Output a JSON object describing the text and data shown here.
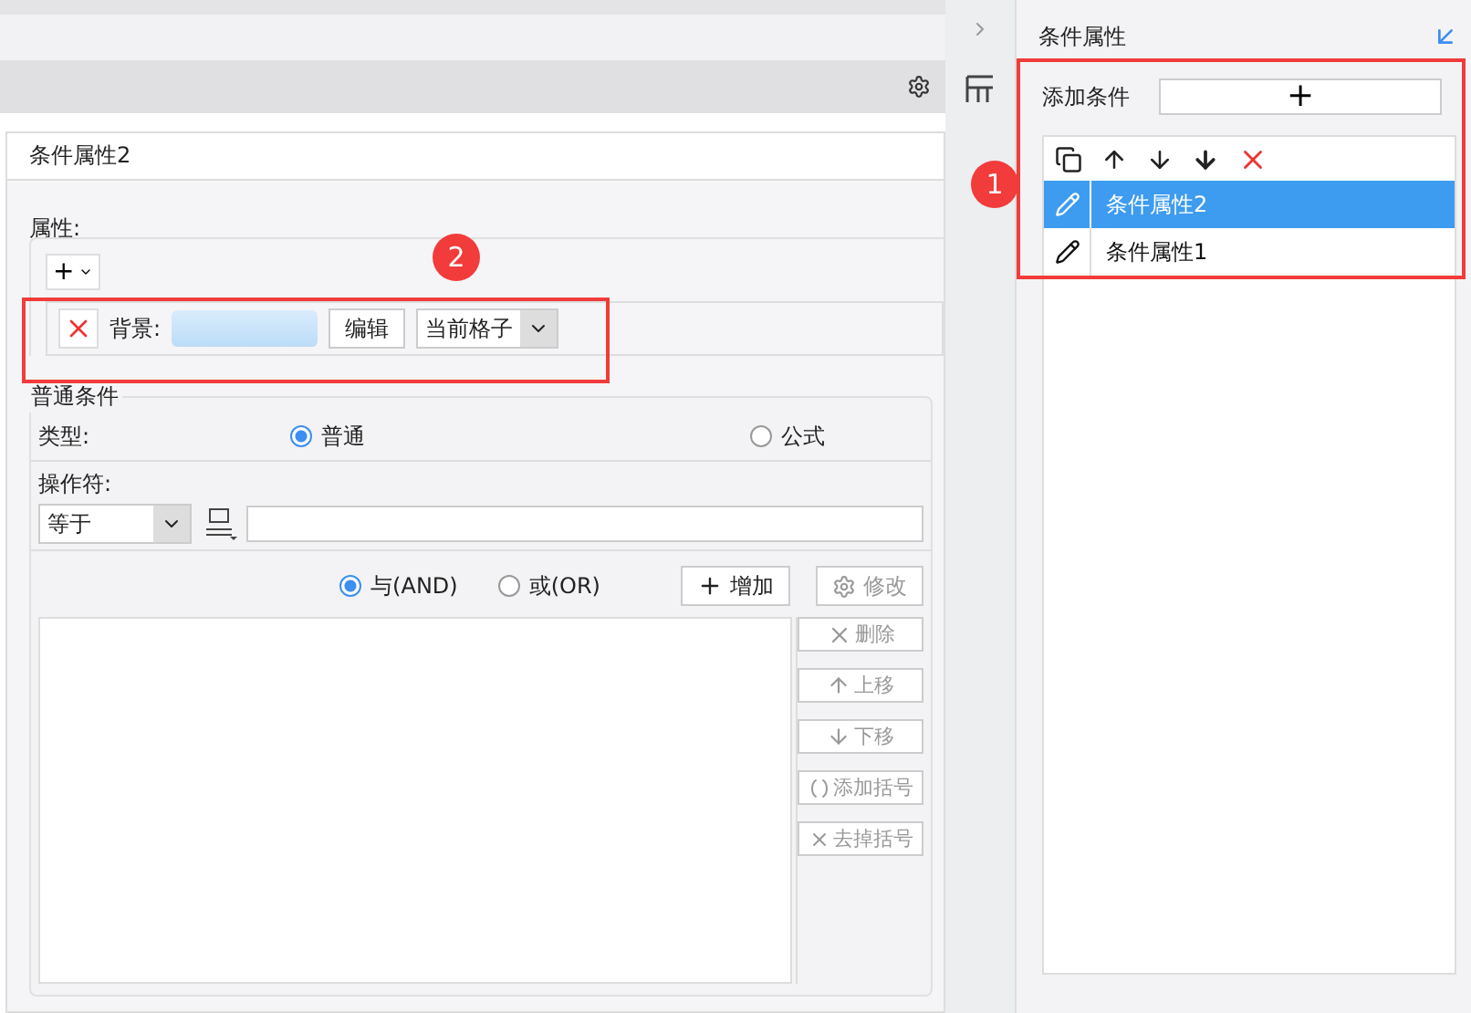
{
  "editor": {
    "tab": "条件属性2",
    "attributes": {
      "label": "属性:",
      "add_button": "+",
      "rows": [
        {
          "label": "背景:",
          "edit_button": "编辑",
          "scope": "当前格子"
        }
      ]
    },
    "condition": {
      "title": "普通条件",
      "type_label": "类型:",
      "types": [
        {
          "label": "普通",
          "selected": true
        },
        {
          "label": "公式",
          "selected": false
        }
      ],
      "operator_label": "操作符:",
      "operator": "等于",
      "logic": [
        {
          "label": "与(AND)",
          "selected": true
        },
        {
          "label": "或(OR)",
          "selected": false
        }
      ],
      "add_button": "增加",
      "modify_button": {
        "label": "修改",
        "disabled": true
      },
      "side_buttons": [
        {
          "kind": "delete",
          "label": "删除",
          "disabled": true
        },
        {
          "kind": "up",
          "label": "上移",
          "disabled": true
        },
        {
          "kind": "down",
          "label": "下移",
          "disabled": true
        },
        {
          "kind": "bracket",
          "label": "添加括号",
          "disabled": true
        },
        {
          "kind": "unbracket",
          "label": "去掉括号",
          "disabled": true
        }
      ]
    }
  },
  "panel": {
    "title": "条件属性",
    "add_label": "添加条件",
    "add_button": "+",
    "items": [
      {
        "label": "条件属性2",
        "selected": true
      },
      {
        "label": "条件属性1",
        "selected": false
      }
    ]
  },
  "annotations": [
    {
      "label": "1"
    },
    {
      "label": "2"
    }
  ]
}
